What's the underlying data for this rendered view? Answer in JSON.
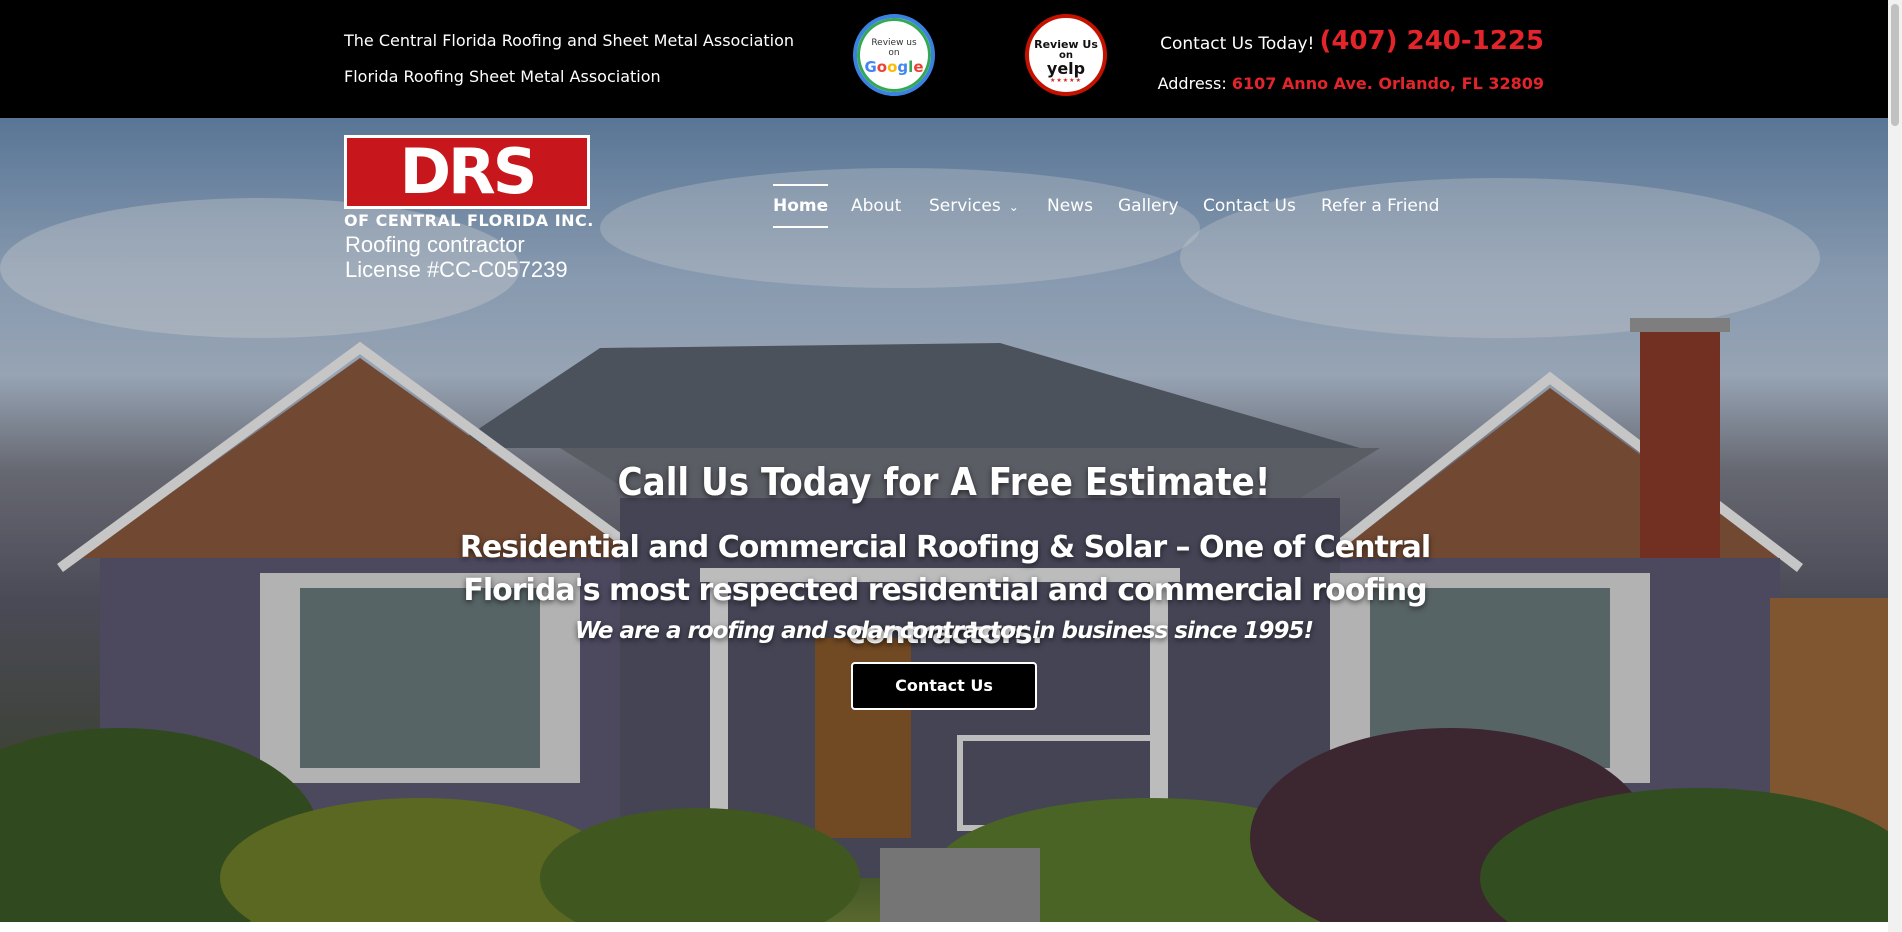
{
  "topbar": {
    "association_1": "The Central Florida Roofing and Sheet Metal Association",
    "association_2": "Florida Roofing Sheet Metal Association",
    "google_badge": {
      "line1": "Review us",
      "line2": "on",
      "brand": "Google"
    },
    "yelp_badge": {
      "line1": "Review Us",
      "line2": "on",
      "brand": "yelp",
      "stars": "★★★★★"
    },
    "contact_prefix": "Contact Us Today!",
    "phone": "(407) 240-1225",
    "address_prefix": "Address:",
    "address": "6107 Anno Ave. Orlando, FL 32809"
  },
  "logo": {
    "letters": "DRS",
    "subtitle": "OF CENTRAL FLORIDA INC.",
    "license_line1": "Roofing contractor",
    "license_line2": "License #CC-C057239"
  },
  "nav": {
    "items": [
      {
        "label": "Home",
        "active": true
      },
      {
        "label": "About"
      },
      {
        "label": "Services",
        "icon": "chevron-down-icon"
      },
      {
        "label": "News"
      },
      {
        "label": "Gallery"
      },
      {
        "label": "Contact Us"
      },
      {
        "label": "Refer a Friend"
      }
    ]
  },
  "hero": {
    "heading": "Call Us Today for A Free Estimate!",
    "subheading": "Residential and Commercial Roofing & Solar – One of Central Florida's most respected residential and commercial roofing contractors.",
    "tagline": "We are a roofing and solar contractor in business since 1995!",
    "cta_label": "Contact Us"
  },
  "colors": {
    "topbar_bg": "#000000",
    "accent_red": "#e3242b",
    "text_white": "#ffffff"
  }
}
